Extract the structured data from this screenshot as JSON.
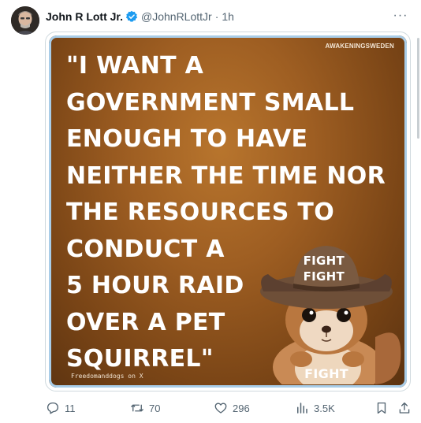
{
  "author": {
    "name": "John R Lott Jr.",
    "handle": "@JohnRLottJr",
    "separator": "·",
    "time": "1h",
    "verified": true
  },
  "menu": {
    "more_icon": "more-horizontal-icon",
    "more_label": "···"
  },
  "media": {
    "watermark_top": "AWAKENINGSWEDEN",
    "quote_lines": [
      "\"I WANT A",
      "GOVERNMENT SMALL",
      "ENOUGH TO HAVE",
      "NEITHER THE TIME NOR",
      "THE RESOURCES TO",
      "CONDUCT A",
      "5 HOUR RAID",
      "OVER A PET",
      "SQUIRREL\""
    ],
    "hat_text_1": "FIGHT",
    "hat_text_2": "FIGHT",
    "chest_text": "FIGHT",
    "watermark_bottom": "Freedomanddogs on X"
  },
  "actions": {
    "replies": "11",
    "reposts": "70",
    "likes": "296",
    "views": "3.5K"
  },
  "colors": {
    "text_secondary": "#536471",
    "verified_blue": "#1d9bf0",
    "border": "#cfd9de",
    "media_brown": "#9e5e22"
  }
}
